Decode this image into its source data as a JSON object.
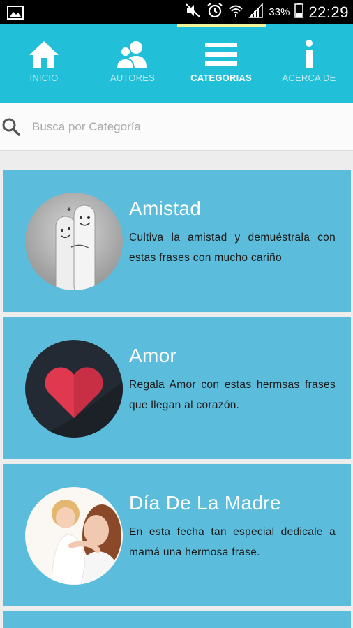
{
  "status_bar": {
    "battery_percent": "33%",
    "time": "22:29",
    "icons": [
      "image-icon",
      "mute-icon",
      "alarm-icon",
      "wifi-icon",
      "signal-icon",
      "battery-icon"
    ]
  },
  "nav": {
    "items": [
      {
        "label": "INICIO",
        "icon": "home-icon"
      },
      {
        "label": "AUTORES",
        "icon": "users-icon"
      },
      {
        "label": "CATEGORIAS",
        "icon": "menu-icon"
      },
      {
        "label": "ACERCA DE",
        "icon": "info-icon"
      }
    ],
    "active_index": 2
  },
  "search": {
    "placeholder": "Busca por Categoría",
    "value": ""
  },
  "categories": [
    {
      "title": "Amistad",
      "description": "Cultiva la amistad y demuéstrala con estas frases con mucho cariño",
      "image": "friendship-fingers-photo"
    },
    {
      "title": "Amor",
      "description": "Regala Amor con estas hermsas frases que llegan al corazón.",
      "image": "heart-icon"
    },
    {
      "title": "Día De La Madre",
      "description": "En esta fecha tan especial dedicale a mamá una hermosa frase.",
      "image": "mother-child-photo"
    }
  ],
  "colors": {
    "nav_bg": "#22c0d8",
    "card_bg": "#5cbcdb",
    "active_indicator": "#eef59a"
  }
}
